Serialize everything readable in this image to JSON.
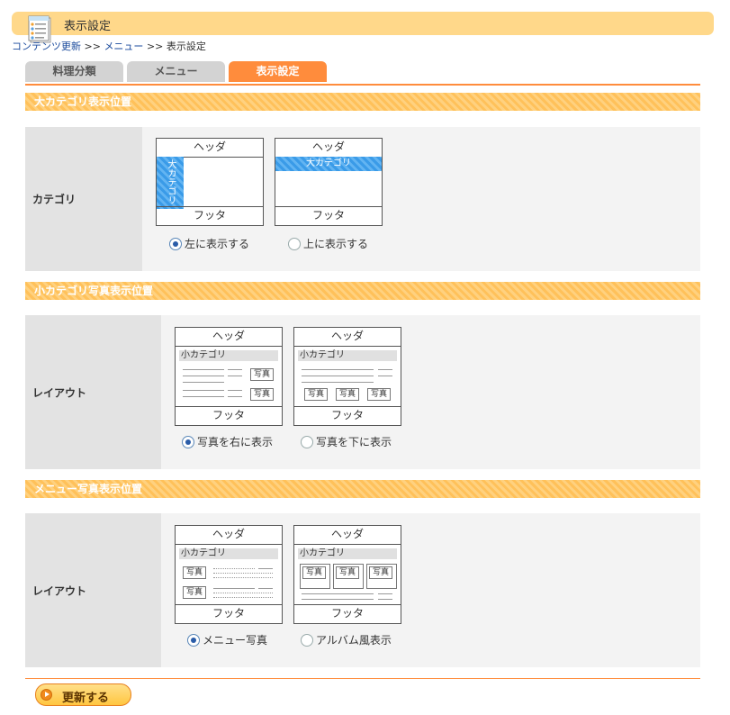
{
  "page": {
    "title": "表示設定",
    "icon": "memo-notepad-icon",
    "breadcrumb": [
      {
        "label": "コンテンツ更新",
        "link": true
      },
      {
        "label": ">>",
        "link": false
      },
      {
        "label": "メニュー",
        "link": true
      },
      {
        "label": ">>",
        "link": false
      },
      {
        "label": "表示設定",
        "link": false
      }
    ]
  },
  "tabs": [
    {
      "label": "料理分類",
      "active": false
    },
    {
      "label": "メニュー",
      "active": false
    },
    {
      "label": "表示設定",
      "active": true
    }
  ],
  "sections": [
    {
      "heading": "大カテゴリ表示位置",
      "row_label": "カテゴリ",
      "options": [
        {
          "header": "ヘッダ",
          "footer": "フッタ",
          "category": "大カテゴリ",
          "label": "左に表示する",
          "selected": true
        },
        {
          "header": "ヘッダ",
          "footer": "フッタ",
          "category": "大カテゴリ",
          "label": "上に表示する",
          "selected": false
        }
      ]
    },
    {
      "heading": "小カテゴリ写真表示位置",
      "row_label": "レイアウト",
      "options": [
        {
          "header": "ヘッダ",
          "footer": "フッタ",
          "category": "小カテゴリ",
          "photo": "写真",
          "label": "写真を右に表示",
          "selected": true
        },
        {
          "header": "ヘッダ",
          "footer": "フッタ",
          "category": "小カテゴリ",
          "photo": "写真",
          "label": "写真を下に表示",
          "selected": false
        }
      ]
    },
    {
      "heading": "メニュー写真表示位置",
      "row_label": "レイアウト",
      "options": [
        {
          "header": "ヘッダ",
          "footer": "フッタ",
          "category": "小カテゴリ",
          "photo": "写真",
          "label": "メニュー写真",
          "selected": true
        },
        {
          "header": "ヘッダ",
          "footer": "フッタ",
          "category": "小カテゴリ",
          "photo": "写真",
          "label": "アルバム風表示",
          "selected": false
        }
      ]
    }
  ],
  "submit": {
    "label": "更新する"
  },
  "colors": {
    "accent": "#ff8c3c",
    "section": "#ffc15a",
    "category_bar": "#3a9be8",
    "title_bar": "#ffd88a"
  }
}
